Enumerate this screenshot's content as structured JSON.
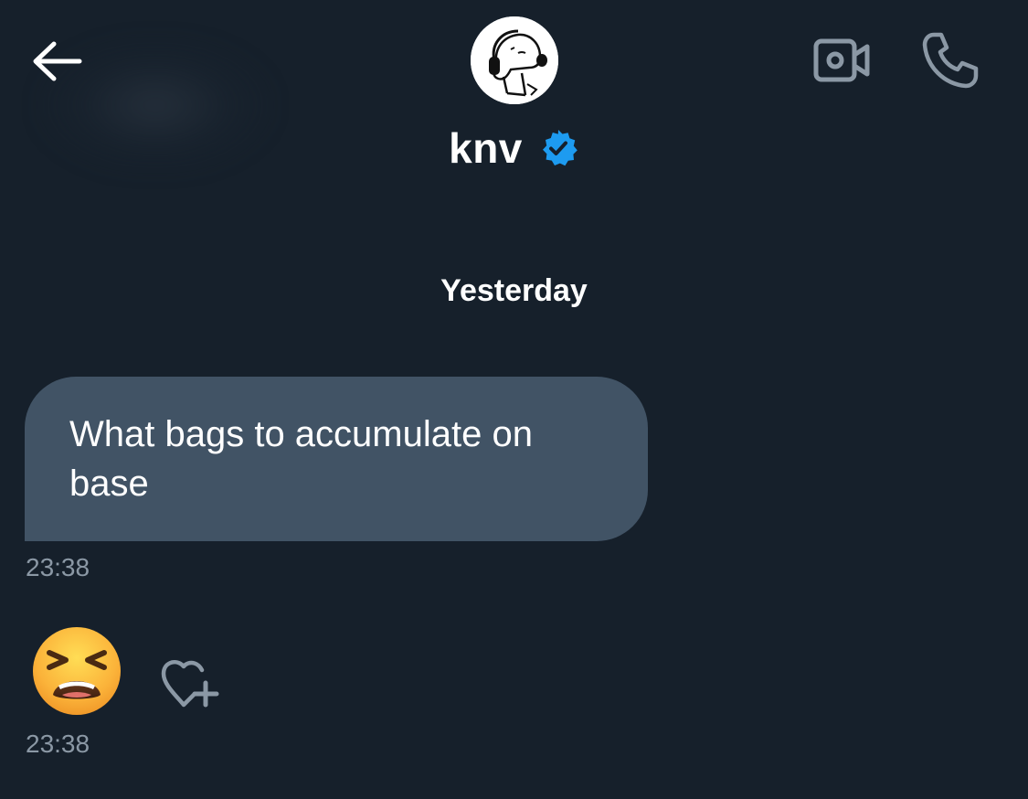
{
  "header": {
    "contact_name": "knv",
    "verified": true
  },
  "conversation": {
    "date_separator": "Yesterday",
    "messages": [
      {
        "text": "What bags to accumulate on base",
        "time": "23:38"
      },
      {
        "emoji": "tired-face",
        "time": "23:38"
      }
    ]
  },
  "icons": {
    "back": "arrow-left-icon",
    "video": "video-camera-icon",
    "call": "phone-icon",
    "verified": "verified-badge-icon",
    "react": "heart-plus-icon"
  },
  "colors": {
    "background": "#16202b",
    "bubble": "#415365",
    "timestamp": "#8b98a5",
    "verified_blue": "#1d9bf0",
    "icon_gray": "#8b98a5"
  }
}
